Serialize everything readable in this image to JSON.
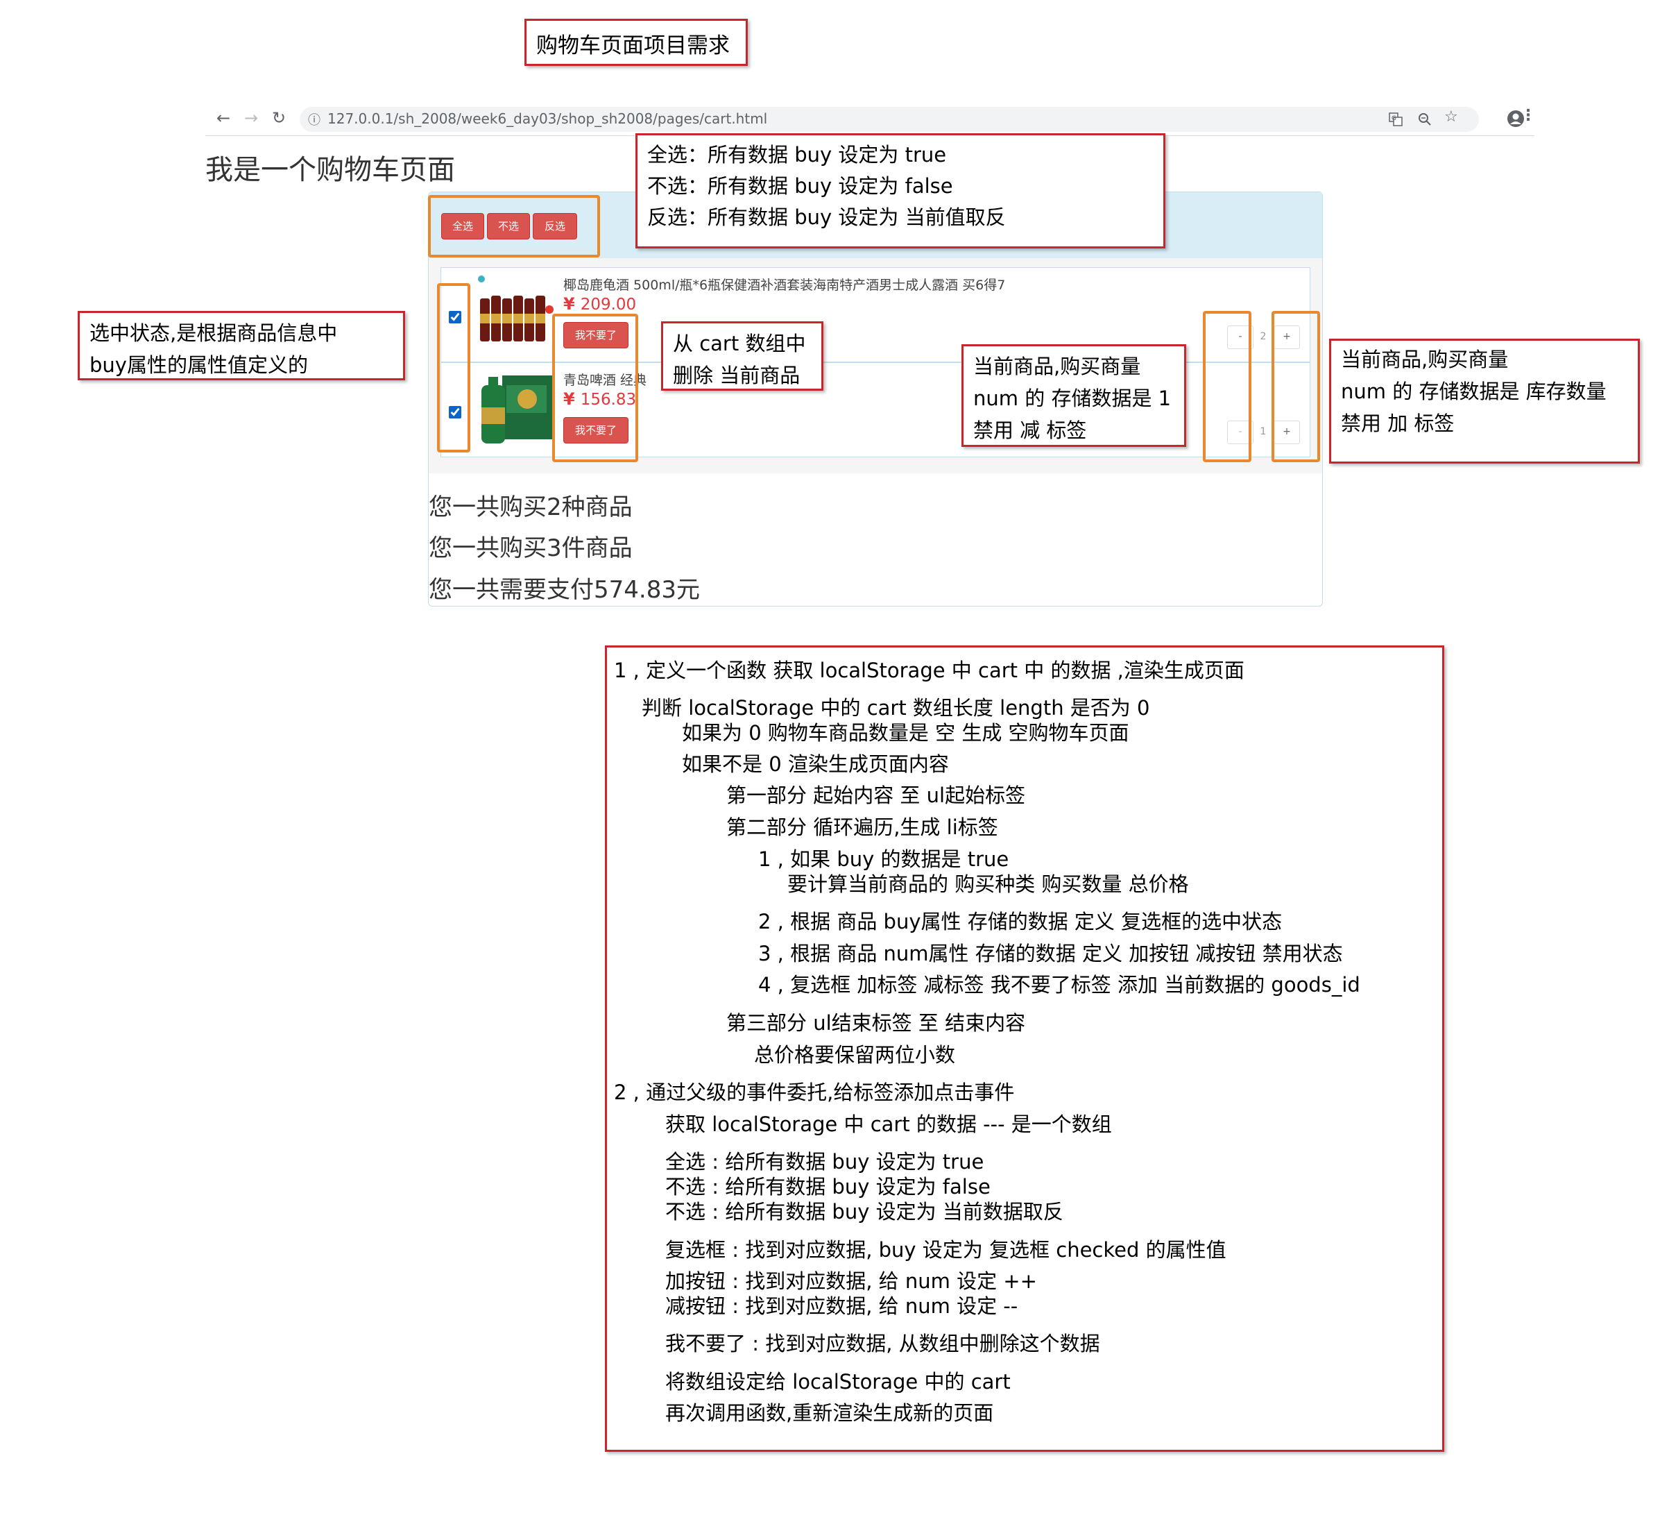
{
  "title_box": "购物车页面项目需求",
  "browser": {
    "back": "←",
    "forward": "→",
    "reload": "↻",
    "info": "ⓘ",
    "url": "127.0.0.1/sh_2008/week6_day03/shop_sh2008/pages/cart.html",
    "icons": [
      "translate-icon",
      "zoom-icon",
      "star-icon",
      "account-icon",
      "menu-icon"
    ]
  },
  "page_heading": "我是一个购物车页面",
  "cart": {
    "buttons": {
      "select_all": "全选",
      "select_none": "不选",
      "invert": "反选"
    },
    "items": [
      {
        "name": "椰岛鹿龟酒 500ml/瓶*6瓶保健酒补酒套装海南特产酒男士成人露酒 买6得7",
        "price": "209.00",
        "currency": "¥",
        "remove": "我不要了",
        "num": "2",
        "minus": "-",
        "plus": "+",
        "checked": true
      },
      {
        "name": "青岛啤酒 经典",
        "price": "156.83",
        "currency": "¥",
        "remove": "我不要了",
        "num": "1",
        "minus": "-",
        "plus": "+",
        "checked": true
      }
    ],
    "summary": [
      "您一共购买2种商品",
      "您一共购买3件商品",
      "您一共需要支付574.83元"
    ]
  },
  "annotations": {
    "select_buttons": [
      "全选：所有数据 buy 设定为 true",
      "不选：所有数据 buy 设定为 false",
      "反选：所有数据 buy 设定为 当前值取反"
    ],
    "checkbox": [
      "选中状态,是根据商品信息中",
      "buy属性的属性值定义的"
    ],
    "remove": [
      "从 cart 数组中",
      "删除 当前商品"
    ],
    "minus": [
      "当前商品,购买商量",
      "num 的 存储数据是 1",
      "禁用 减 标签"
    ],
    "plus": [
      "当前商品,购买商量",
      "num 的 存储数据是 库存数量",
      "禁用 加 标签"
    ]
  },
  "requirements": [
    "1 , 定义一个函数 获取 localStorage 中 cart 中 的数据 ,渲染生成页面",
    "判断 localStorage 中的 cart 数组长度 length 是否为 0",
    "如果为 0 购物车商品数量是 空 生成 空购物车页面",
    "如果不是 0 渲染生成页面内容",
    "第一部分 起始内容 至  ul起始标签",
    "第二部分 循环遍历,生成 li标签",
    "1 , 如果 buy 的数据是 true",
    "要计算当前商品的 购买种类  购买数量   总价格",
    "2 , 根据 商品 buy属性 存储的数据 定义 复选框的选中状态",
    "3 , 根据 商品 num属性 存储的数据 定义 加按钮 减按钮 禁用状态",
    "4 , 复选框  加标签  减标签  我不要了标签  添加  当前数据的  goods_id",
    "第三部分 ul结束标签 至 结束内容",
    "总价格要保留两位小数",
    "2 , 通过父级的事件委托,给标签添加点击事件",
    "获取 localStorage 中 cart 的数据 --- 是一个数组",
    "全选 : 给所有数据 buy 设定为 true",
    "不选 : 给所有数据 buy 设定为 false",
    "不选 : 给所有数据 buy 设定为 当前数据取反",
    "复选框 : 找到对应数据, buy 设定为 复选框 checked 的属性值",
    "加按钮 : 找到对应数据, 给 num 设定 ++",
    "减按钮 : 找到对应数据, 给 num 设定 --",
    "我不要了 : 找到对应数据, 从数组中删除这个数据",
    "将数组设定给 localStorage 中的 cart",
    "再次调用函数,重新渲染生成新的页面"
  ]
}
